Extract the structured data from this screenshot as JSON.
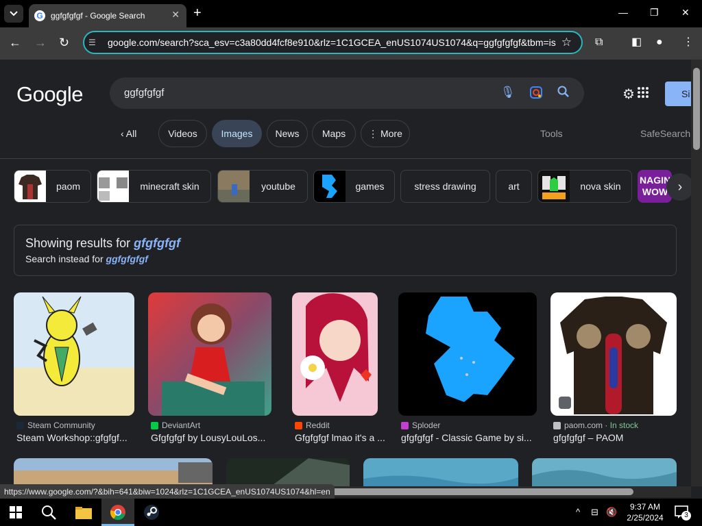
{
  "browser": {
    "tab_title": "ggfgfgfgf - Google Search",
    "url": "google.com/search?sca_esv=c3a80dd4fcf8e910&rlz=1C1GCEA_enUS1074US1074&q=ggfgfgfgf&tbm=isch",
    "status_url": "https://www.google.com/?&bih=641&biw=1024&rlz=1C1GCEA_enUS1074US1074&hl=en"
  },
  "google": {
    "logo": "Google",
    "query": "ggfgfgfgf",
    "signin_label": "Si"
  },
  "search_tabs": [
    {
      "label": "All"
    },
    {
      "label": "Videos"
    },
    {
      "label": "Images"
    },
    {
      "label": "News"
    },
    {
      "label": "Maps"
    },
    {
      "label": "More"
    }
  ],
  "tools_label": "Tools",
  "safesearch_label": "SafeSearch",
  "refine_chips": [
    {
      "label": "paom"
    },
    {
      "label": "minecraft skin"
    },
    {
      "label": "youtube"
    },
    {
      "label": "games"
    },
    {
      "label": "stress drawing"
    },
    {
      "label": "art"
    },
    {
      "label": "nova skin"
    },
    {
      "label": "NAGIN WOW"
    }
  ],
  "correction": {
    "showing_prefix": "Showing results for",
    "showing_term": "gfgfgfgf",
    "instead_prefix": "Search instead for",
    "instead_term": "ggfgfgfgf"
  },
  "results": [
    {
      "source": "Steam Community",
      "title": "Steam Workshop::gfgfgf..."
    },
    {
      "source": "DeviantArt",
      "title": "Gfgfgfgf by LousyLouLos..."
    },
    {
      "source": "Reddit",
      "title": "Gfgfgfgf lmao it's a ..."
    },
    {
      "source": "Sploder",
      "title": "gfgfgfgf - Classic Game by si..."
    },
    {
      "source": "paom.com",
      "stock": "In stock",
      "title": "gfgfgfgf – PAOM"
    }
  ],
  "taskbar": {
    "time": "9:37 AM",
    "date": "2/25/2024",
    "notifications": "3"
  }
}
